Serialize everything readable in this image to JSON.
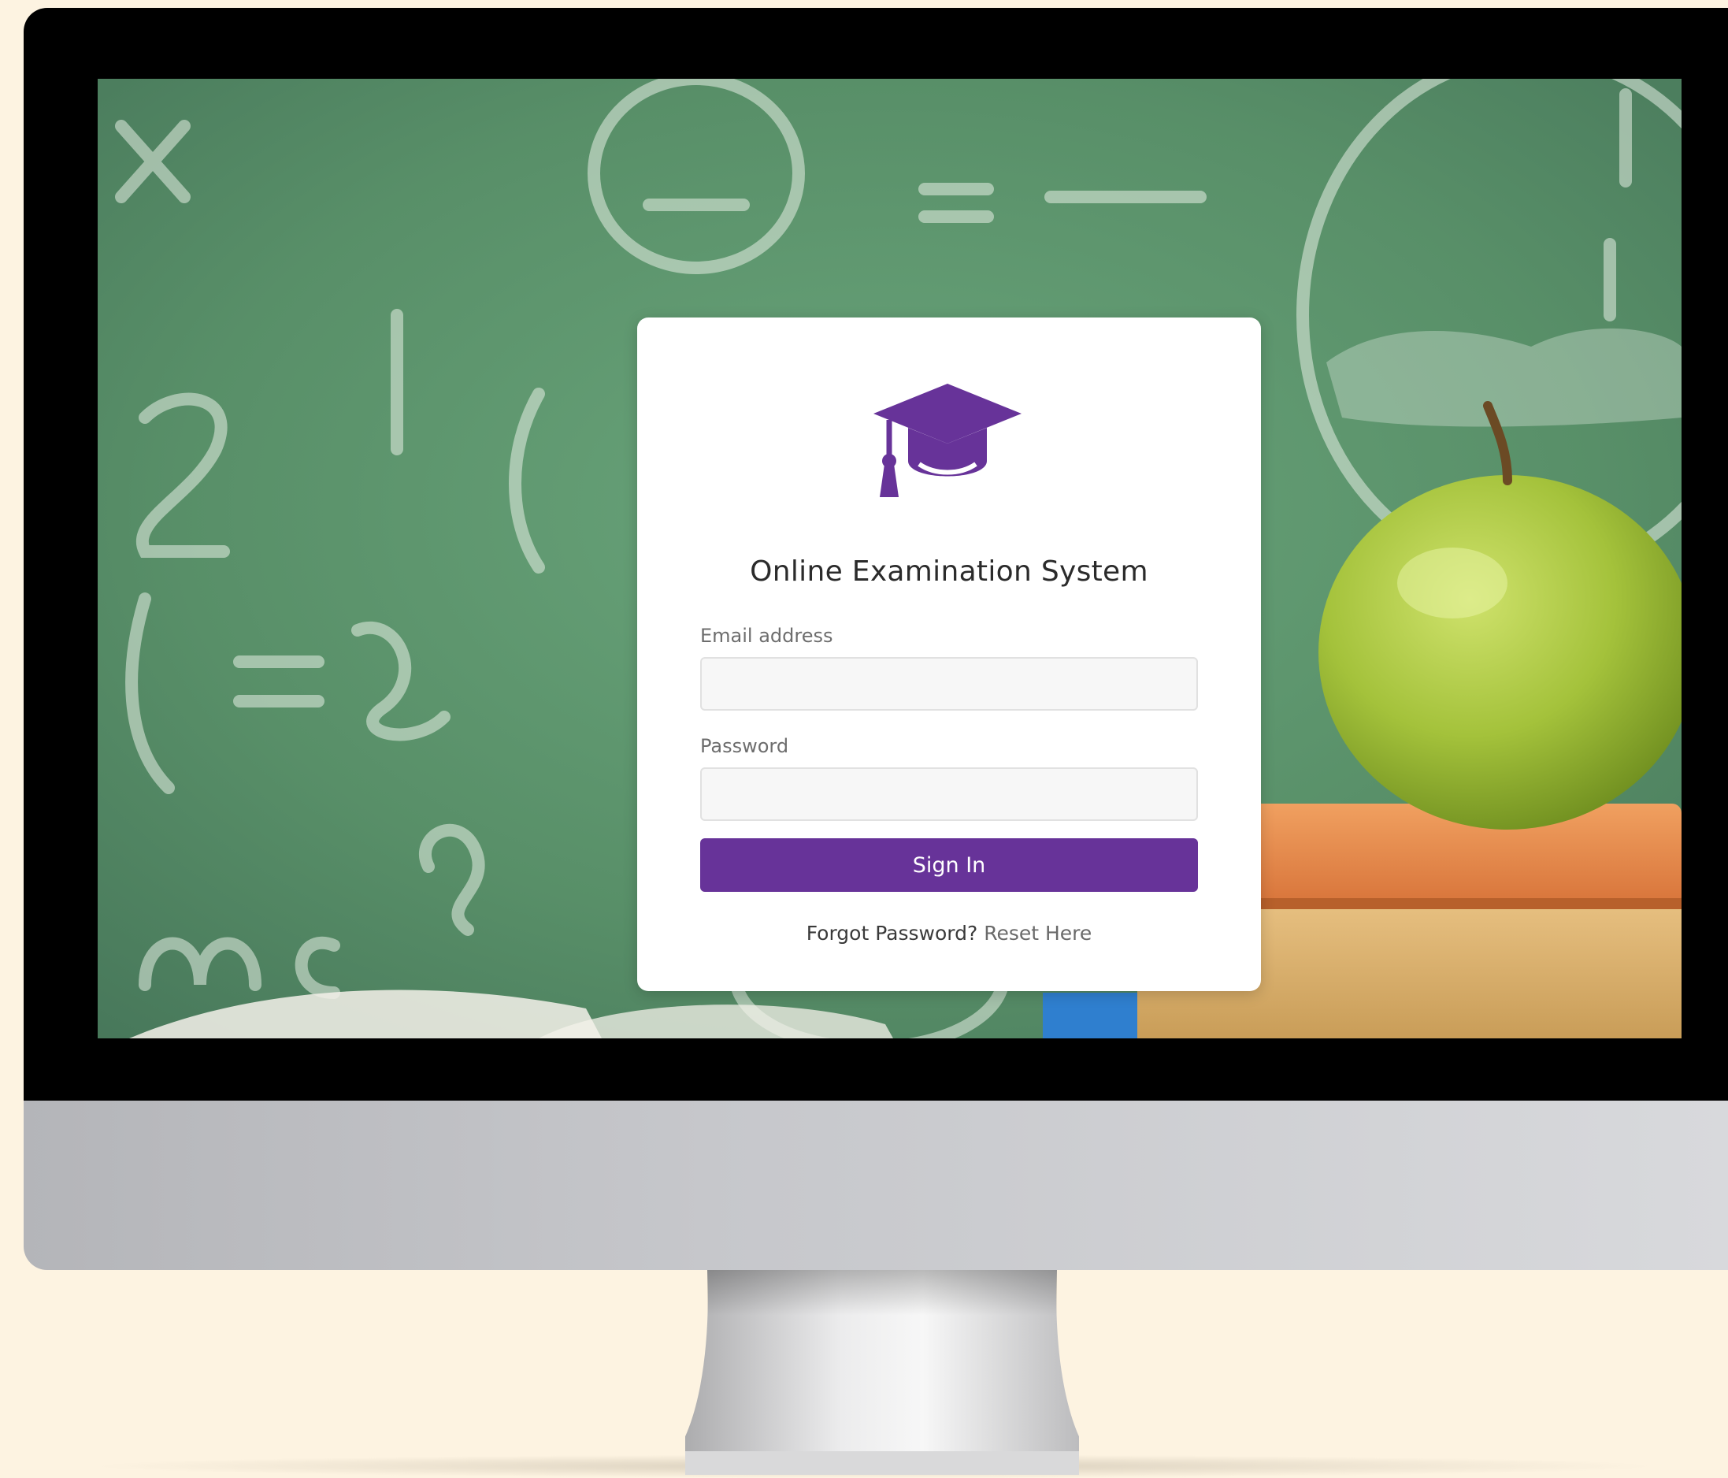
{
  "login": {
    "title": "Online Examination System",
    "email_label": "Email address",
    "email_value": "",
    "password_label": "Password",
    "password_value": "",
    "signin_label": "Sign In",
    "forgot_text": "Forgot Password?",
    "reset_link": "Reset Here"
  },
  "icons": {
    "logo": "graduation-cap-icon"
  },
  "colors": {
    "accent": "#673399",
    "page_background": "#fdf3e1",
    "chalkboard": "#5e9a6e"
  }
}
